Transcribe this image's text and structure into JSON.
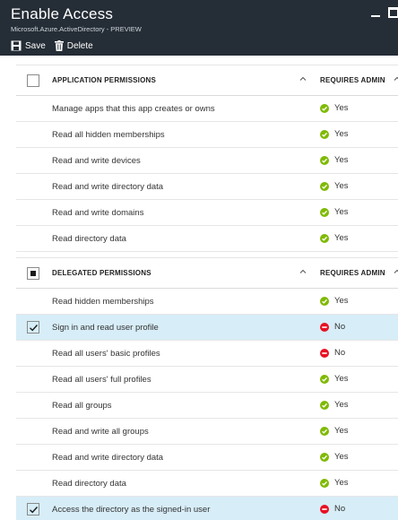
{
  "window": {
    "title": "Enable Access",
    "subtitle": "Microsoft.Azure.ActiveDirectory - PREVIEW"
  },
  "toolbar": {
    "save_label": "Save",
    "delete_label": "Delete"
  },
  "application": {
    "header": "APPLICATION PERMISSIONS",
    "admin_header": "REQUIRES ADMIN",
    "checkbox_state": "unchecked",
    "rows": [
      {
        "label": "Manage apps that this app creates or owns",
        "admin": "Yes",
        "checked": false
      },
      {
        "label": "Read all hidden memberships",
        "admin": "Yes",
        "checked": false
      },
      {
        "label": "Read and write devices",
        "admin": "Yes",
        "checked": false
      },
      {
        "label": "Read and write directory data",
        "admin": "Yes",
        "checked": false
      },
      {
        "label": "Read and write domains",
        "admin": "Yes",
        "checked": false
      },
      {
        "label": "Read directory data",
        "admin": "Yes",
        "checked": false
      }
    ]
  },
  "delegated": {
    "header": "DELEGATED PERMISSIONS",
    "admin_header": "REQUIRES ADMIN",
    "checkbox_state": "indeterminate",
    "rows": [
      {
        "label": "Read hidden memberships",
        "admin": "Yes",
        "checked": false
      },
      {
        "label": "Sign in and read user profile",
        "admin": "No",
        "checked": true
      },
      {
        "label": "Read all users' basic profiles",
        "admin": "No",
        "checked": false
      },
      {
        "label": "Read all users' full profiles",
        "admin": "Yes",
        "checked": false
      },
      {
        "label": "Read all groups",
        "admin": "Yes",
        "checked": false
      },
      {
        "label": "Read and write all groups",
        "admin": "Yes",
        "checked": false
      },
      {
        "label": "Read and write directory data",
        "admin": "Yes",
        "checked": false
      },
      {
        "label": "Read directory data",
        "admin": "Yes",
        "checked": false
      },
      {
        "label": "Access the directory as the signed-in user",
        "admin": "No",
        "checked": true
      }
    ]
  },
  "colors": {
    "titlebar": "#252d36",
    "selected_row": "#d7edf7",
    "yes_icon": "#7fba00",
    "no_icon": "#e81123"
  },
  "icons": {
    "yes": "green-check-circle-icon",
    "no": "red-minus-circle-icon",
    "sort": "chevron-up-icon",
    "save": "floppy-disk-icon",
    "delete": "trash-icon"
  }
}
